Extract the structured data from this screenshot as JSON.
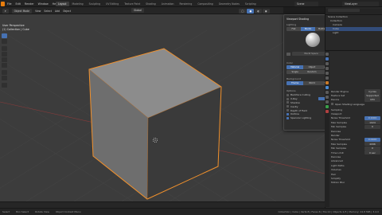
{
  "topbar": {
    "menus": [
      "File",
      "Edit",
      "Render",
      "Window",
      "Help"
    ],
    "workspace_tabs": [
      "Layout",
      "Modeling",
      "Sculpting",
      "UV Editing",
      "Texture Paint",
      "Shading",
      "Animation",
      "Rendering",
      "Compositing",
      "Geometry Nodes",
      "Scripting"
    ],
    "active_tab_index": 0,
    "scene": "Scene",
    "view_layer": "ViewLayer"
  },
  "header": {
    "mode": "Object Mode",
    "menus": [
      "View",
      "Select",
      "Add",
      "Object"
    ],
    "orientation": "Global"
  },
  "viewport": {
    "view_name": "User Perspective",
    "collection": "(1) Collection | Cube"
  },
  "shading_popover": {
    "title": "Viewport Shading",
    "lighting_label": "Lighting",
    "lighting_options": [
      "Flat",
      "Studio",
      "MatCap"
    ],
    "lighting_active": 1,
    "world_space_label": "World Space",
    "color_label": "Color",
    "color_options": [
      "Material",
      "Object",
      "Attribute",
      "Single",
      "Random",
      "Texture"
    ],
    "color_active": 0,
    "background_label": "Background",
    "background_options": [
      "Theme",
      "World",
      "Viewport"
    ],
    "background_active": 0,
    "options_label": "Options",
    "options": [
      {
        "label": "Backface Culling",
        "on": false
      },
      {
        "label": "X-Ray",
        "on": false
      },
      {
        "label": "Shadow",
        "on": false
      },
      {
        "label": "Cavity",
        "on": false
      },
      {
        "label": "Depth of Field",
        "on": false
      },
      {
        "label": "Outline",
        "on": true
      },
      {
        "label": "Specular Lighting",
        "on": true
      }
    ]
  },
  "outliner": {
    "search_placeholder": "",
    "items": [
      "Scene Collection",
      "Collection",
      "Camera",
      "Cube",
      "Light"
    ],
    "selected_index": 3
  },
  "properties": {
    "render_engine_label": "Render Engine",
    "render_engine": "Cycles",
    "feature_set_label": "Feature Set",
    "feature_set": "Supported",
    "device_label": "Device",
    "device": "CPU",
    "osl_label": "Open Shading Language",
    "sections": [
      "Sampling",
      "Viewport",
      "Noise Threshold",
      "Max Samples",
      "Min Samples",
      "Denoise",
      "Render",
      "Noise Threshold",
      "Max Samples",
      "Min Samples",
      "Time Limit",
      "Denoise",
      "Advanced",
      "Light Paths",
      "Volumes",
      "Hair",
      "Simplify",
      "Motion Blur"
    ],
    "values": {
      "noise_threshold_vp": "0.1000",
      "max_samples_vp": "1024",
      "min_samples_vp": "0",
      "noise_threshold_r": "0.0100",
      "max_samples_r": "4096",
      "min_samples_r": "0",
      "time_limit": "0 sec"
    }
  },
  "statusbar": {
    "items": [
      "Select",
      "Box Select",
      "Rotate View",
      "Object Context Menu"
    ],
    "right": "Collection | Cube | Verts:8 | Faces:6 | Tris:12 | Objects:1/3 | Memory: 24.8 MiB | 3.4.0"
  },
  "colors": {
    "accent": "#4772b3",
    "selection_outline": "#f0902c",
    "background": "#3c3c3c"
  }
}
